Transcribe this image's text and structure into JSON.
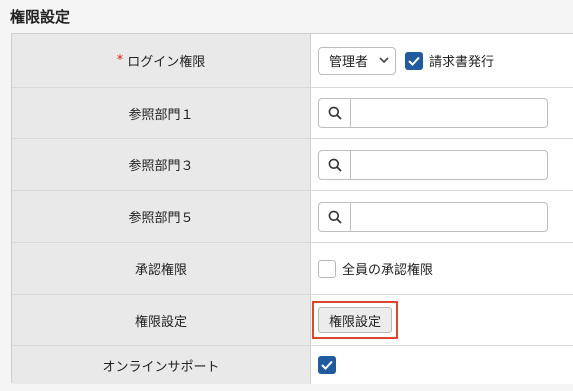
{
  "section_title": "権限設定",
  "rows": {
    "login": {
      "required_mark": "*",
      "label": "ログイン権限",
      "select_value": "管理者",
      "checkbox_label": "請求書発行",
      "checkbox_checked": true
    },
    "dept1": {
      "label": "参照部門１"
    },
    "dept3": {
      "label": "参照部門３"
    },
    "dept5": {
      "label": "参照部門５"
    },
    "approval": {
      "label": "承認権限",
      "checkbox_label": "全員の承認権限",
      "checkbox_checked": false
    },
    "permission": {
      "label": "権限設定",
      "button_label": "権限設定"
    },
    "support": {
      "label": "オンラインサポート",
      "checkbox_checked": true
    }
  },
  "colors": {
    "accent": "#1f5b9e",
    "highlight_border": "#e0452f",
    "required": "#d92020",
    "label_bg": "#e9e9e9"
  },
  "icons": {
    "search": "magnifier-icon",
    "select": "chevron-down-icon",
    "check": "checkmark-icon"
  }
}
